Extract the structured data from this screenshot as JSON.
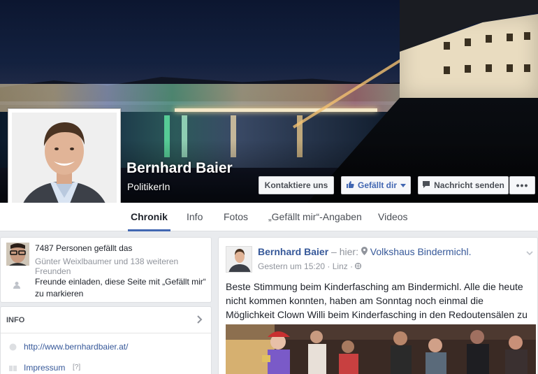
{
  "page": {
    "name": "Bernhard Baier",
    "category": "PolitikerIn"
  },
  "actions": {
    "contact_label": "Kontaktiere uns",
    "like_label": "Gefällt dir",
    "message_label": "Nachricht senden",
    "more_label": "•••"
  },
  "nav": {
    "tabs": [
      {
        "label": "Chronik"
      },
      {
        "label": "Info"
      },
      {
        "label": "Fotos"
      },
      {
        "label": "„Gefällt mir“-Angaben"
      },
      {
        "label": "Videos"
      }
    ]
  },
  "likes": {
    "count_text": "7487 Personen gefällt das",
    "friends_text": "Günter Weixlbaumer und 138 weiteren Freunden",
    "invite_text": "Freunde einladen, diese Seite mit „Gefällt mir“ zu markieren"
  },
  "info": {
    "heading": "INFO",
    "website": "http://www.bernhardbaier.at/",
    "imprint": "Impressum",
    "imprint_hint": "[?]"
  },
  "post": {
    "author": "Bernhard Baier",
    "location_prefix": "– hier:",
    "location": "Volkshaus Bindermichl.",
    "time": "Gestern um 15:20",
    "place": "Linz",
    "text": "Beste Stimmung beim Kinderfasching am Bindermichl. Alle die heute nicht kommen konnten, haben am Sonntag noch einmal die Möglichkeit Clown Willi beim Kinderfasching in den Redoutensälen zu erleben."
  },
  "colors": {
    "accent": "#4267b2",
    "link": "#365899",
    "background": "#e9ebee"
  }
}
